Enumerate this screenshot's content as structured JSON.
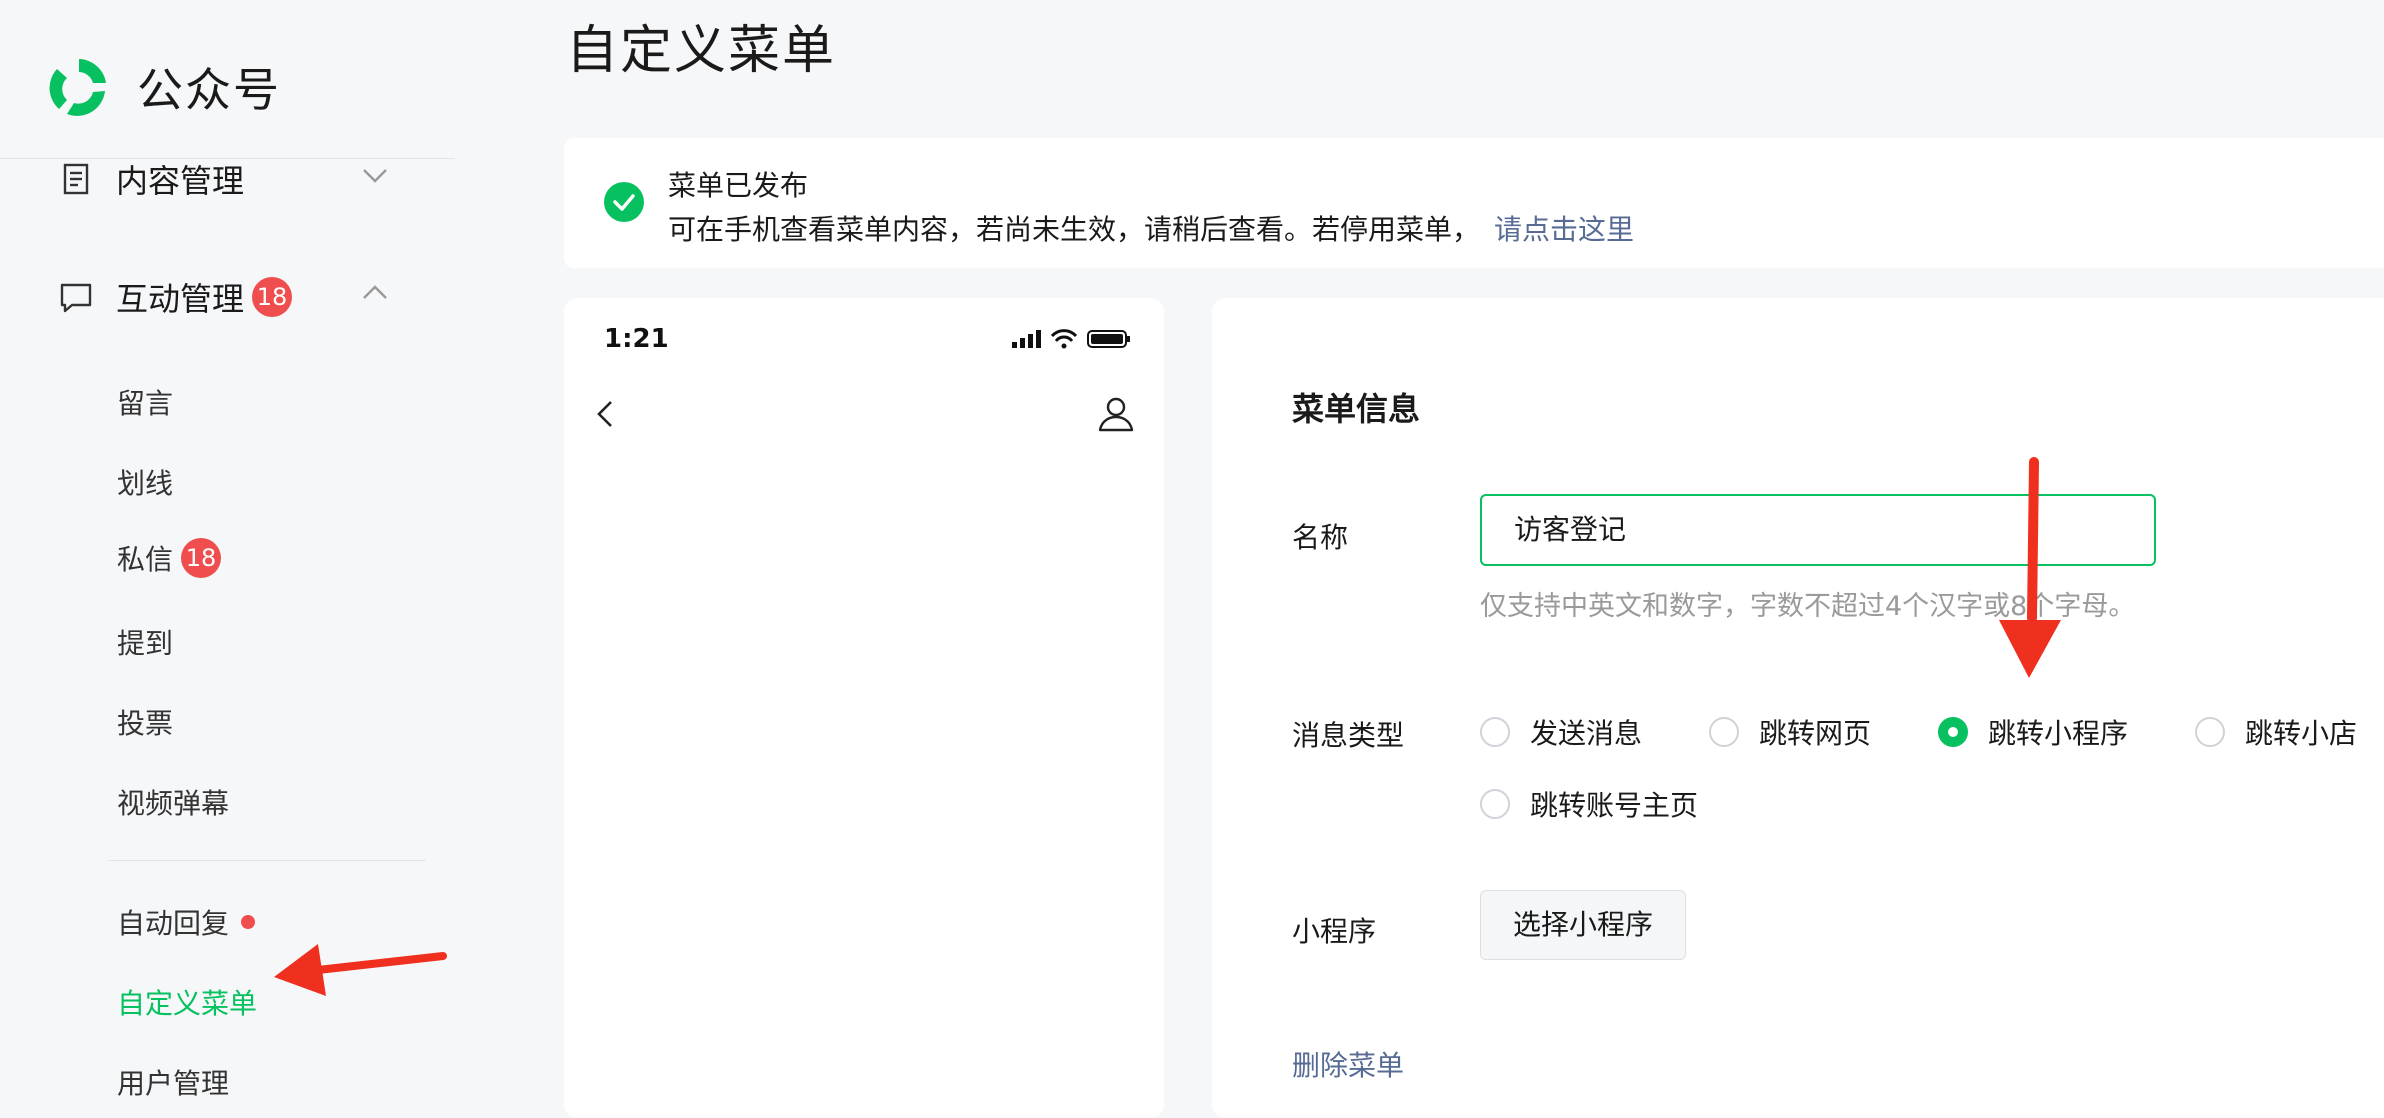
{
  "brand": {
    "name": "公众号"
  },
  "sidebar": {
    "groups": [
      {
        "label": "内容管理",
        "icon": "document-icon",
        "expanded": false
      },
      {
        "label": "互动管理",
        "icon": "chat-bubble-icon",
        "badge": "18",
        "expanded": true
      }
    ],
    "items": [
      {
        "label": "留言"
      },
      {
        "label": "划线"
      },
      {
        "label": "私信",
        "badge": "18"
      },
      {
        "label": "提到"
      },
      {
        "label": "投票"
      },
      {
        "label": "视频弹幕"
      },
      {
        "label": "自动回复",
        "dot": true
      },
      {
        "label": "自定义菜单",
        "active": true
      },
      {
        "label": "用户管理"
      }
    ]
  },
  "page": {
    "title": "自定义菜单"
  },
  "notice": {
    "title": "菜单已发布",
    "text": "可在手机查看菜单内容，若尚未生效，请稍后查看。若停用菜单，",
    "link": "请点击这里"
  },
  "phone": {
    "time": "1:21"
  },
  "form": {
    "section_title": "菜单信息",
    "name_label": "名称",
    "name_value": "访客登记",
    "name_hint": "仅支持中英文和数字，字数不超过4个汉字或8个字母。",
    "type_label": "消息类型",
    "types": [
      "发送消息",
      "跳转网页",
      "跳转小程序",
      "跳转小店",
      "跳转账号主页"
    ],
    "selected_type": "跳转小程序",
    "miniprogram_label": "小程序",
    "miniprogram_button": "选择小程序",
    "delete_label": "删除菜单"
  },
  "colors": {
    "accent": "#07c160",
    "link": "#576b95",
    "badge": "#f04e4e",
    "annotation_arrow": "#f0301e"
  }
}
